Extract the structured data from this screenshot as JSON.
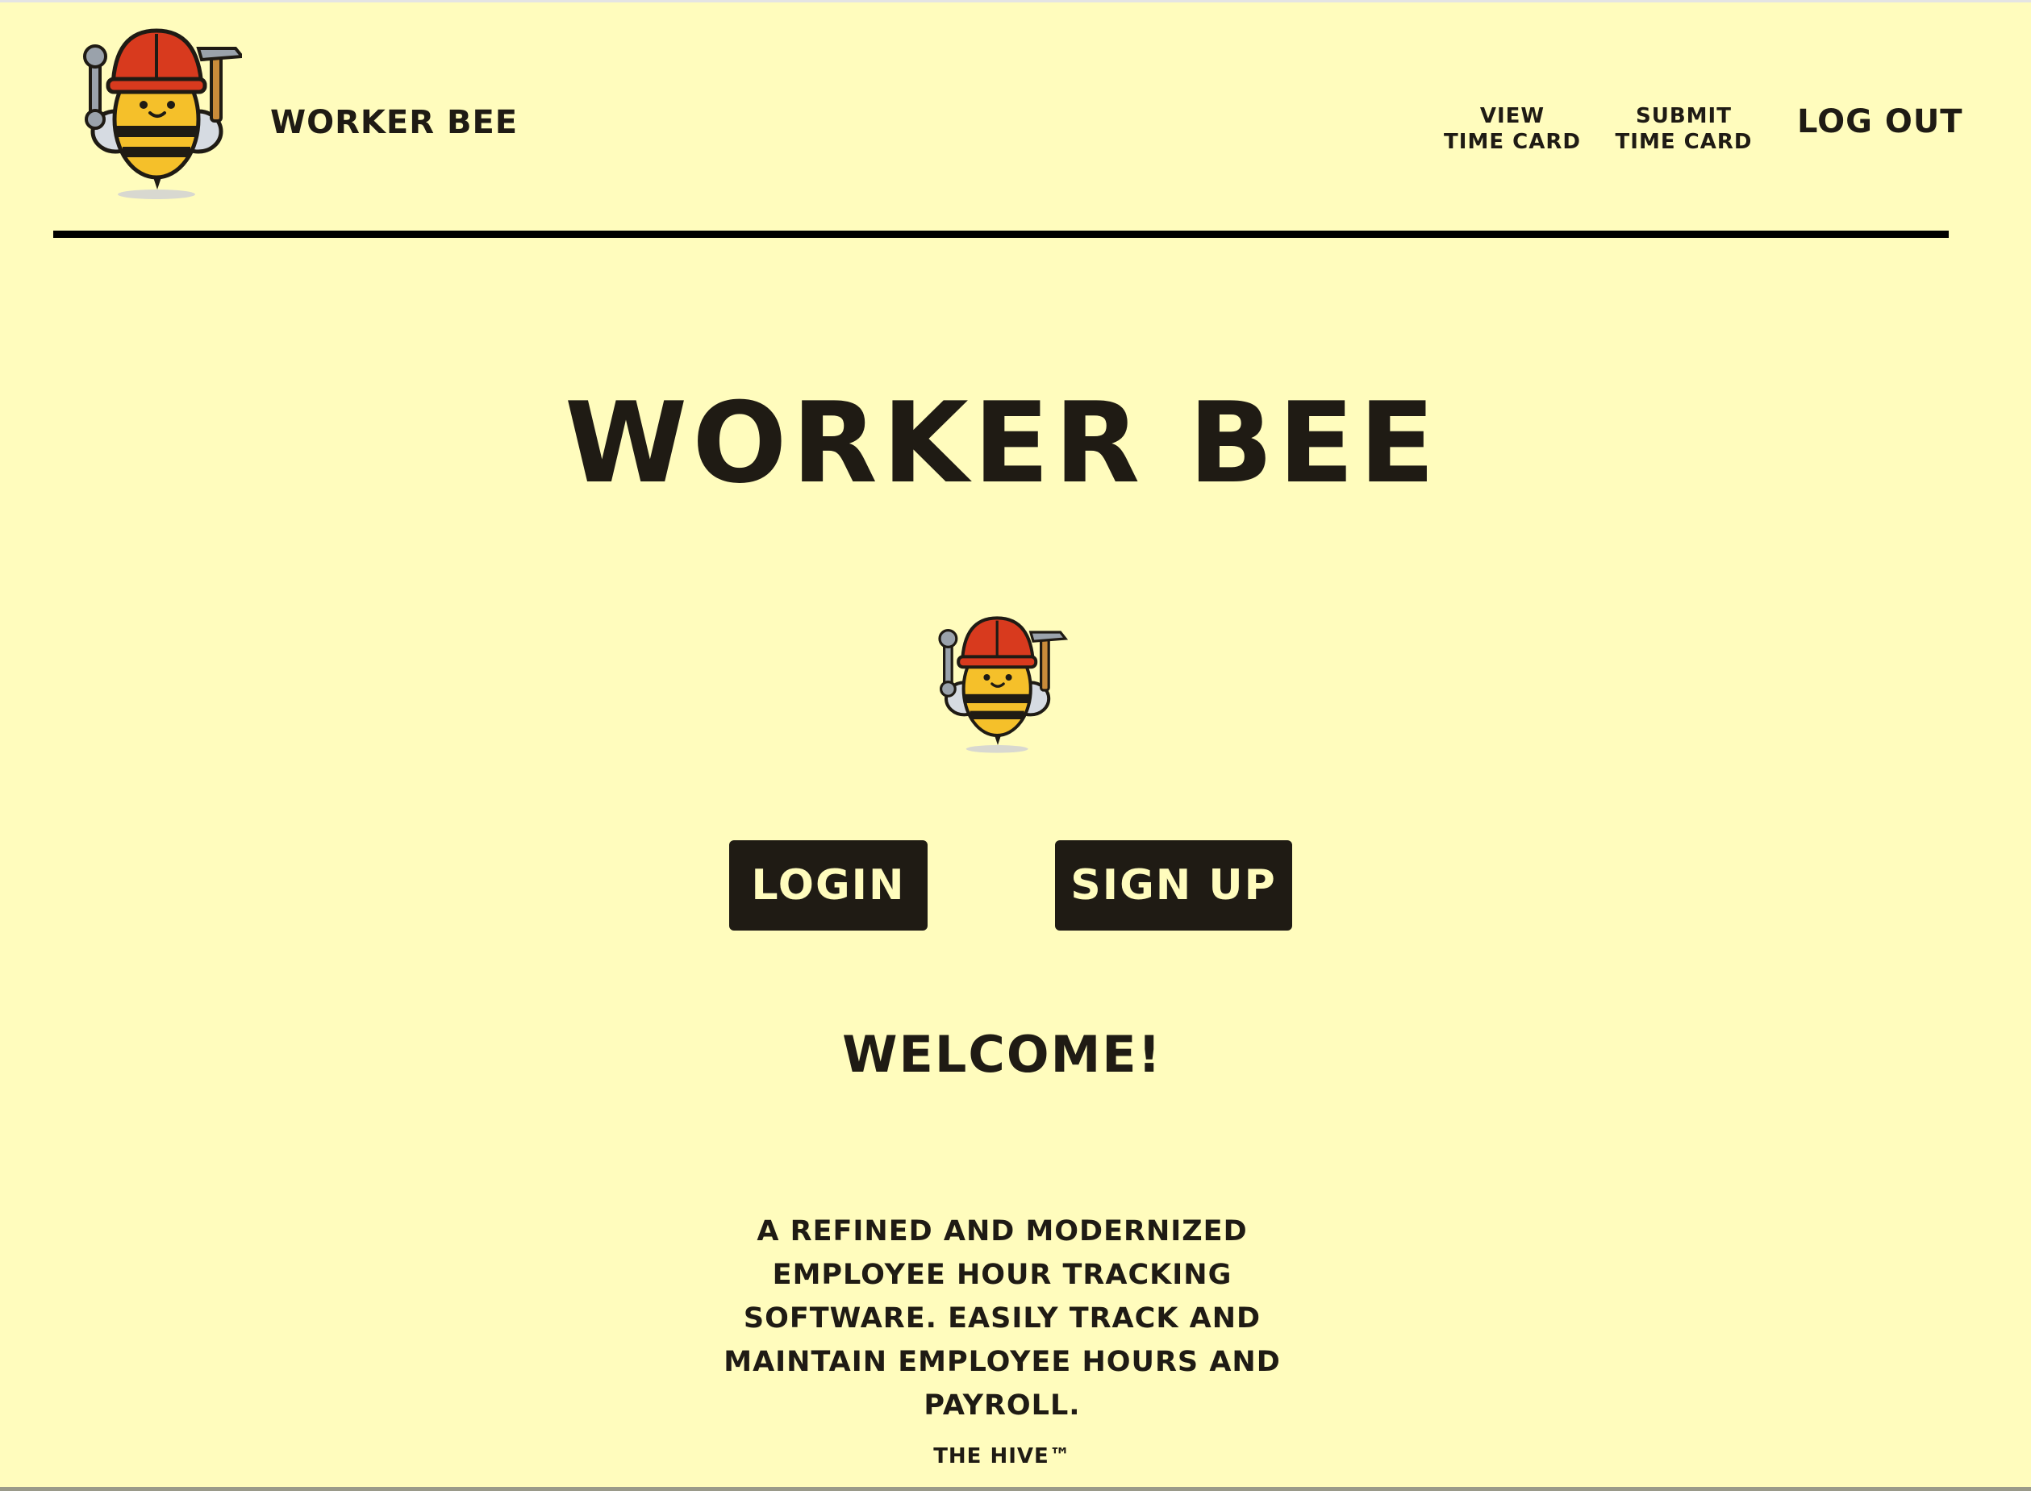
{
  "header": {
    "brand": "Worker Bee",
    "nav": {
      "view_line1": "View",
      "view_line2": "Time Card",
      "submit_line1": "Submit",
      "submit_line2": "Time Card",
      "logout": "Log Out"
    }
  },
  "main": {
    "title": "Worker Bee",
    "login_label": "Login",
    "signup_label": "Sign Up",
    "welcome": "Welcome!",
    "description": "A refined and modernized employee hour tracking software. Easily track and maintain employee hours and payroll."
  },
  "footer": {
    "text": "The Hive™"
  },
  "icons": {
    "logo": "bee-mascot-icon"
  },
  "colors": {
    "background": "#fffcbd",
    "text": "#1f1b14",
    "button_bg": "#1f1b14",
    "button_text": "#fffcbd",
    "helmet": "#d83a1e",
    "bee_body": "#f5c02a"
  }
}
